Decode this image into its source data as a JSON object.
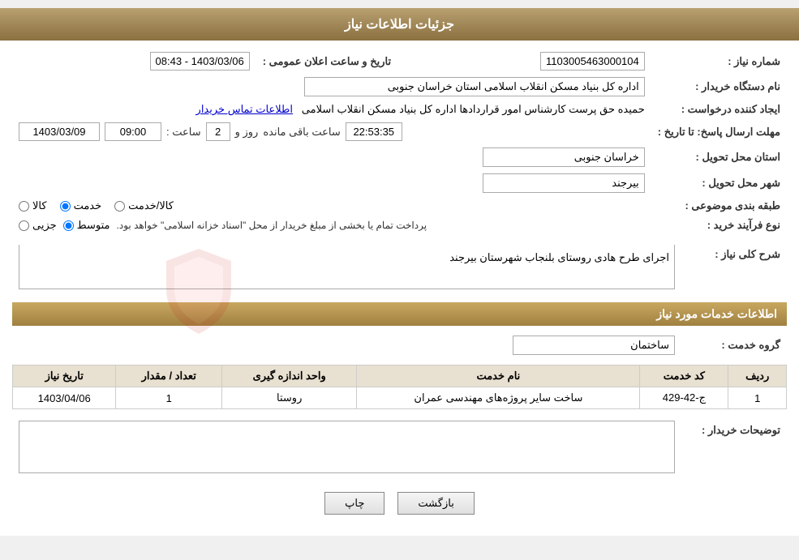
{
  "header": {
    "title": "جزئیات اطلاعات نیاز"
  },
  "info": {
    "need_number_label": "شماره نیاز :",
    "need_number_value": "1103005463000104",
    "announce_date_label": "تاریخ و ساعت اعلان عمومی :",
    "announce_date_value": "1403/03/06 - 08:43",
    "buyer_org_label": "نام دستگاه خریدار :",
    "buyer_org_value": "اداره کل بنیاد مسکن انقلاب اسلامی استان خراسان جنوبی",
    "creator_label": "ایجاد کننده درخواست :",
    "creator_value": "حمیده حق پرست کارشناس امور قراردادها اداره کل بنیاد مسکن انقلاب اسلامی",
    "creator_link": "اطلاعات تماس خریدار",
    "deadline_label": "مهلت ارسال پاسخ: تا تاریخ :",
    "deadline_date": "1403/03/09",
    "deadline_time_label": "ساعت :",
    "deadline_time": "09:00",
    "deadline_days_label": "روز و",
    "deadline_days": "2",
    "countdown_label": "ساعت باقی مانده",
    "countdown_value": "22:53:35",
    "province_label": "استان محل تحویل :",
    "province_value": "خراسان جنوبی",
    "city_label": "شهر محل تحویل :",
    "city_value": "بیرجند",
    "category_label": "طبقه بندی موضوعی :",
    "category_options": [
      {
        "id": "kala",
        "label": "کالا",
        "checked": false
      },
      {
        "id": "khadamat",
        "label": "خدمت",
        "checked": true
      },
      {
        "id": "kala_khadamat",
        "label": "کالا/خدمت",
        "checked": false
      }
    ],
    "purchase_type_label": "نوع فرآیند خرید :",
    "purchase_type_options": [
      {
        "id": "jozii",
        "label": "جزیی",
        "checked": false
      },
      {
        "id": "motavasset",
        "label": "متوسط",
        "checked": true
      }
    ],
    "purchase_note": "پرداخت تمام یا بخشی از مبلغ خریدار از محل \"اسناد خزانه اسلامی\" خواهد بود.",
    "need_description_label": "شرح کلی نیاز :",
    "need_description_value": "اجرای طرح هادی روستای بلنجاب شهرستان بیرجند"
  },
  "services_section": {
    "title": "اطلاعات خدمات مورد نیاز",
    "service_group_label": "گروه خدمت :",
    "service_group_value": "ساختمان",
    "table": {
      "columns": [
        "ردیف",
        "کد خدمت",
        "نام خدمت",
        "واحد اندازه گیری",
        "تعداد / مقدار",
        "تاریخ نیاز"
      ],
      "rows": [
        {
          "row_num": "1",
          "service_code": "ج-42-429",
          "service_name": "ساخت سایر پروژه‌های مهندسی عمران",
          "unit": "روستا",
          "quantity": "1",
          "date": "1403/04/06"
        }
      ]
    }
  },
  "buyer_notes": {
    "label": "توضیحات خریدار :",
    "value": ""
  },
  "buttons": {
    "print_label": "چاپ",
    "back_label": "بازگشت"
  }
}
